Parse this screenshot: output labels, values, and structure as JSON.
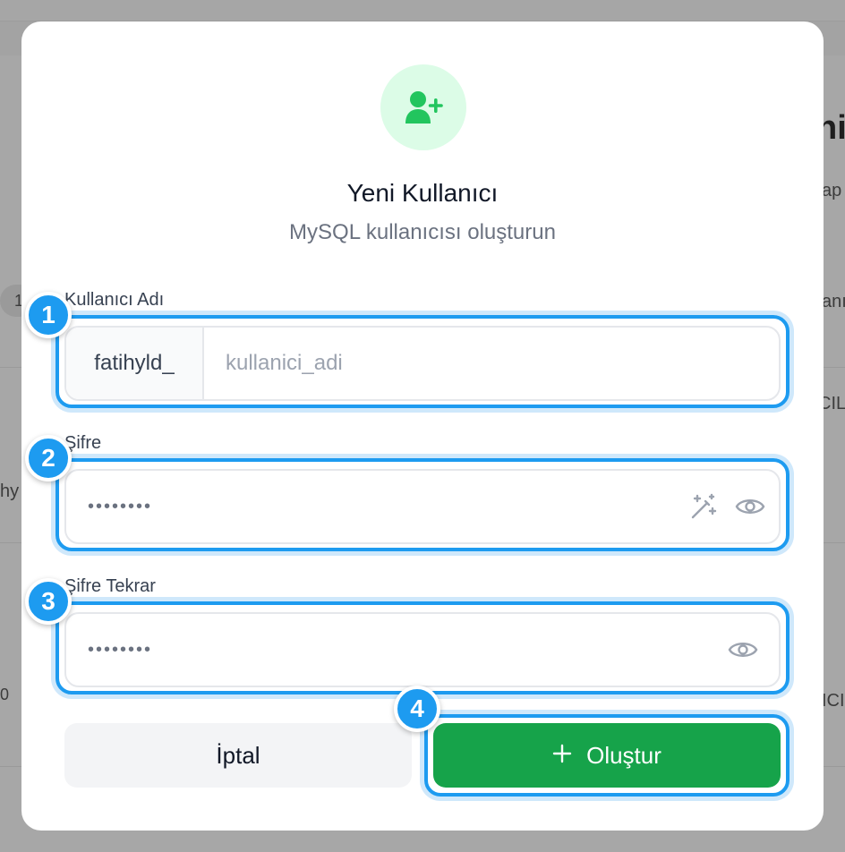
{
  "background": {
    "title_fragment": "ni",
    "text_fragments": [
      "ap",
      "anı",
      "CIL",
      "hy",
      "ICI"
    ],
    "pill_number": "1",
    "pill2_number": "0"
  },
  "modal": {
    "icon": "user-plus-icon",
    "title": "Yeni Kullanıcı",
    "subtitle": "MySQL kullanıcısı oluşturun",
    "username": {
      "label": "Kullanıcı Adı",
      "prefix": "fatihyld_",
      "placeholder": "kullanici_adi"
    },
    "password": {
      "label": "Şifre",
      "value": "••••••••",
      "generate_icon": "magic-wand-icon",
      "toggle_icon": "eye-icon"
    },
    "password_confirm": {
      "label": "Şifre Tekrar",
      "value": "••••••••",
      "toggle_icon": "eye-icon"
    },
    "buttons": {
      "cancel": "İptal",
      "create": "Oluştur",
      "create_icon": "plus-icon"
    }
  },
  "annotations": {
    "badges": [
      "1",
      "2",
      "3",
      "4"
    ],
    "color": "#1d9bf0"
  },
  "colors": {
    "accent_green": "#16a34a",
    "icon_bg": "#dcfce7"
  }
}
